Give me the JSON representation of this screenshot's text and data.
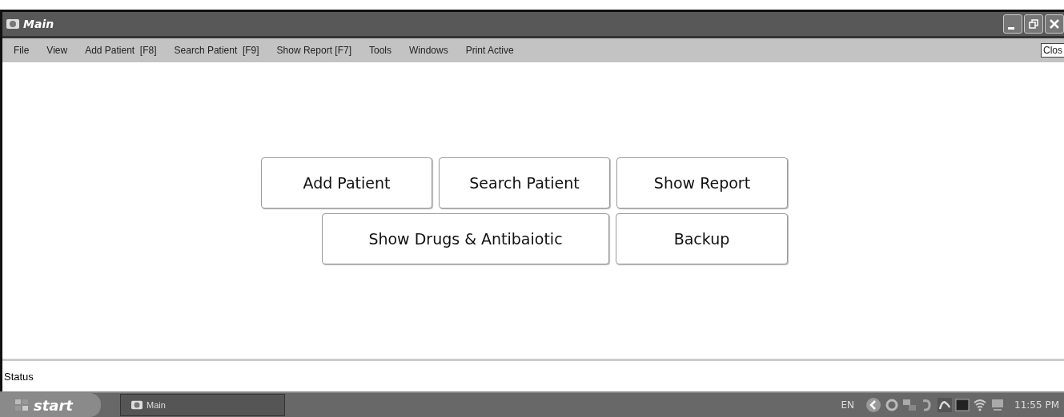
{
  "window": {
    "title": "Main"
  },
  "menu": [
    "File",
    "View",
    "Add Patient  [F8]",
    "Search Patient  [F9]",
    "Show Report [F7]",
    "Tools",
    "Windows",
    "Print Active"
  ],
  "close_button": "Clos",
  "button_rows": [
    [
      "Add Patient",
      "Search Patient",
      "Show Report"
    ],
    [
      "Show Drugs & Antibaiotic",
      "Backup"
    ]
  ],
  "status_bar": "Status",
  "taskbar": {
    "start": "start",
    "task": "Main",
    "language": "EN",
    "clock": "11:55 PM"
  }
}
